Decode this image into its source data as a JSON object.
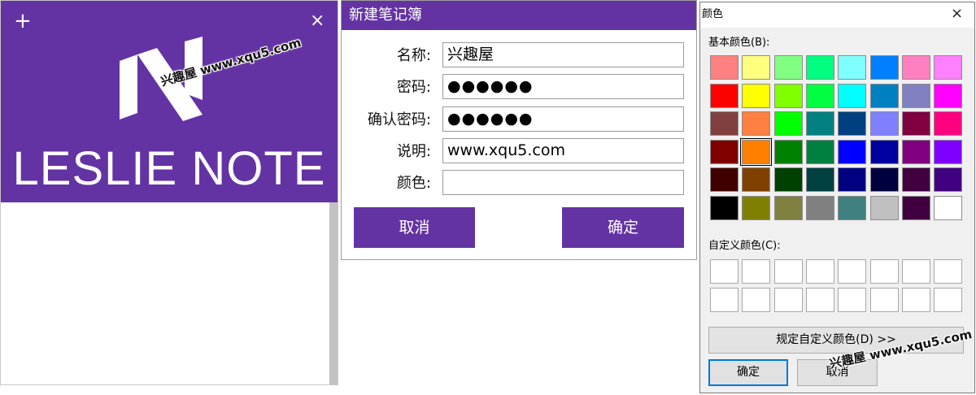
{
  "theme": {
    "purple": "#6433a3",
    "accent_blue": "#0078d7"
  },
  "app": {
    "title": "LESLIE NOTE",
    "add_icon": "+",
    "close_icon": "×",
    "watermark": "兴趣屋 www.xqu5.com"
  },
  "new_notebook": {
    "title": "新建笔记簿",
    "fields": [
      {
        "label": "名称:",
        "value": "兴趣屋"
      },
      {
        "label": "密码:",
        "value": "●●●●●●"
      },
      {
        "label": "确认密码:",
        "value": "●●●●●●"
      },
      {
        "label": "说明:",
        "value": "www.xqu5.com"
      },
      {
        "label": "颜色:",
        "value": ""
      }
    ],
    "cancel_label": "取消",
    "ok_label": "确定"
  },
  "color_dialog": {
    "title": "颜色",
    "close_icon": "×",
    "basic_label": "基本颜色(B):",
    "custom_label": "自定义颜色(C):",
    "define_custom_label": "规定自定义颜色(D) >>",
    "ok_label": "确定",
    "cancel_label": "取消",
    "watermark": "兴趣屋 www.xqu5.com",
    "selected_index": 25,
    "basic_colors": [
      "#ff8080",
      "#ffff80",
      "#80ff80",
      "#00ff80",
      "#80ffff",
      "#0080ff",
      "#ff80c0",
      "#ff80ff",
      "#ff0000",
      "#ffff00",
      "#80ff00",
      "#00ff40",
      "#00ffff",
      "#0080c0",
      "#8080c0",
      "#ff00ff",
      "#804040",
      "#ff8040",
      "#00ff00",
      "#008080",
      "#004080",
      "#8080ff",
      "#800040",
      "#ff0080",
      "#800000",
      "#ff8000",
      "#008000",
      "#008040",
      "#0000ff",
      "#0000a0",
      "#800080",
      "#8000ff",
      "#400000",
      "#804000",
      "#004000",
      "#004040",
      "#000080",
      "#000040",
      "#400040",
      "#400080",
      "#000000",
      "#808000",
      "#808040",
      "#808080",
      "#408080",
      "#c0c0c0",
      "#400040",
      "#ffffff"
    ],
    "custom_colors": [
      "#ffffff",
      "#ffffff",
      "#ffffff",
      "#ffffff",
      "#ffffff",
      "#ffffff",
      "#ffffff",
      "#ffffff",
      "#ffffff",
      "#ffffff",
      "#ffffff",
      "#ffffff",
      "#ffffff",
      "#ffffff",
      "#ffffff",
      "#ffffff"
    ]
  }
}
